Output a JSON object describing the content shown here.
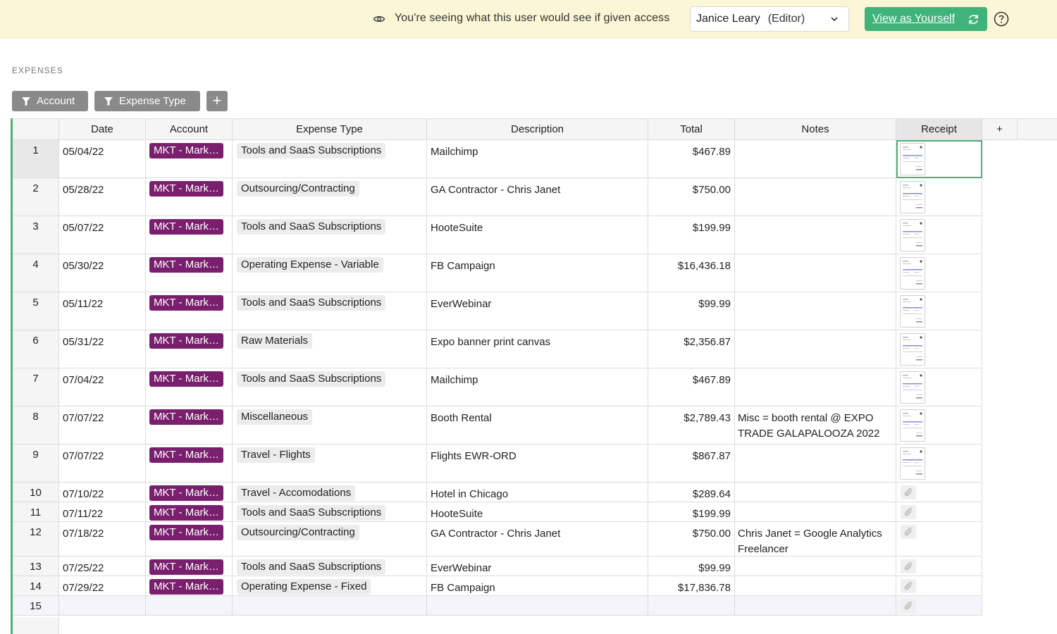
{
  "banner": {
    "message": "You're seeing what this user would see if given access",
    "user_name": "Janice Leary",
    "user_role": "(Editor)",
    "view_button": "View as Yourself"
  },
  "section_title": "EXPENSES",
  "filters": [
    {
      "label": "Account"
    },
    {
      "label": "Expense Type"
    }
  ],
  "add_filter": "+",
  "columns": [
    "",
    "Date",
    "Account",
    "Expense Type",
    "Description",
    "Total",
    "Notes",
    "Receipt",
    "+"
  ],
  "rows": [
    {
      "num": "1",
      "date": "05/04/22",
      "account": "MKT - Mark…",
      "type": "Tools and SaaS Subscriptions",
      "desc": "Mailchimp",
      "total": "$467.89",
      "notes": "",
      "receipt": "thumbnail"
    },
    {
      "num": "2",
      "date": "05/28/22",
      "account": "MKT - Mark…",
      "type": "Outsourcing/Contracting",
      "desc": "GA Contractor - Chris Janet",
      "total": "$750.00",
      "notes": "",
      "receipt": "thumbnail"
    },
    {
      "num": "3",
      "date": "05/07/22",
      "account": "MKT - Mark…",
      "type": "Tools and SaaS Subscriptions",
      "desc": "HooteSuite",
      "total": "$199.99",
      "notes": "",
      "receipt": "thumbnail"
    },
    {
      "num": "4",
      "date": "05/30/22",
      "account": "MKT - Mark…",
      "type": "Operating Expense - Variable",
      "desc": "FB Campaign",
      "total": "$16,436.18",
      "notes": "",
      "receipt": "thumbnail"
    },
    {
      "num": "5",
      "date": "05/11/22",
      "account": "MKT - Mark…",
      "type": "Tools and SaaS Subscriptions",
      "desc": "EverWebinar",
      "total": "$99.99",
      "notes": "",
      "receipt": "thumbnail"
    },
    {
      "num": "6",
      "date": "05/31/22",
      "account": "MKT - Mark…",
      "type": "Raw Materials",
      "desc": "Expo banner print canvas",
      "total": "$2,356.87",
      "notes": "",
      "receipt": "thumbnail"
    },
    {
      "num": "7",
      "date": "07/04/22",
      "account": "MKT - Mark…",
      "type": "Tools and SaaS Subscriptions",
      "desc": "Mailchimp",
      "total": "$467.89",
      "notes": "",
      "receipt": "thumbnail"
    },
    {
      "num": "8",
      "date": "07/07/22",
      "account": "MKT - Mark…",
      "type": "Miscellaneous",
      "desc": "Booth Rental",
      "total": "$2,789.43",
      "notes": "Misc = booth rental @ EXPO TRADE GALAPALOOZA 2022",
      "receipt": "thumbnail"
    },
    {
      "num": "9",
      "date": "07/07/22",
      "account": "MKT - Mark…",
      "type": "Travel - Flights",
      "desc": "Flights EWR-ORD",
      "total": "$867.87",
      "notes": "",
      "receipt": "thumbnail"
    },
    {
      "num": "10",
      "date": "07/10/22",
      "account": "MKT - Mark…",
      "type": "Travel - Accomodations",
      "desc": "Hotel in Chicago",
      "total": "$289.64",
      "notes": "",
      "receipt": "attach"
    },
    {
      "num": "11",
      "date": "07/11/22",
      "account": "MKT - Mark…",
      "type": "Tools and SaaS Subscriptions",
      "desc": "HooteSuite",
      "total": "$199.99",
      "notes": "",
      "receipt": "attach"
    },
    {
      "num": "12",
      "date": "07/18/22",
      "account": "MKT - Mark…",
      "type": "Outsourcing/Contracting",
      "desc": "GA Contractor - Chris Janet",
      "total": "$750.00",
      "notes": "Chris Janet = Google Analytics Freelancer",
      "receipt": "attach"
    },
    {
      "num": "13",
      "date": "07/25/22",
      "account": "MKT - Mark…",
      "type": "Tools and SaaS Subscriptions",
      "desc": "EverWebinar",
      "total": "$99.99",
      "notes": "",
      "receipt": "attach"
    },
    {
      "num": "14",
      "date": "07/29/22",
      "account": "MKT - Mark…",
      "type": "Operating Expense - Fixed",
      "desc": "FB Campaign",
      "total": "$17,836.78",
      "notes": "",
      "receipt": "attach"
    },
    {
      "num": "15",
      "date": "",
      "account": "",
      "type": "",
      "desc": "",
      "total": "",
      "notes": "",
      "receipt": "attach"
    }
  ],
  "colors": {
    "banner_bg": "#fbf6d6",
    "accent_green": "#3fb37a",
    "account_pill": "#7a1f6e",
    "filter_btn": "#8a8a8a"
  },
  "icons": {
    "eye": "eye-icon",
    "chevron": "chevron-down-icon",
    "refresh": "refresh-icon",
    "help": "help-icon",
    "filter": "filter-icon",
    "attach": "paperclip-icon",
    "receipt": "receipt-thumbnail"
  }
}
